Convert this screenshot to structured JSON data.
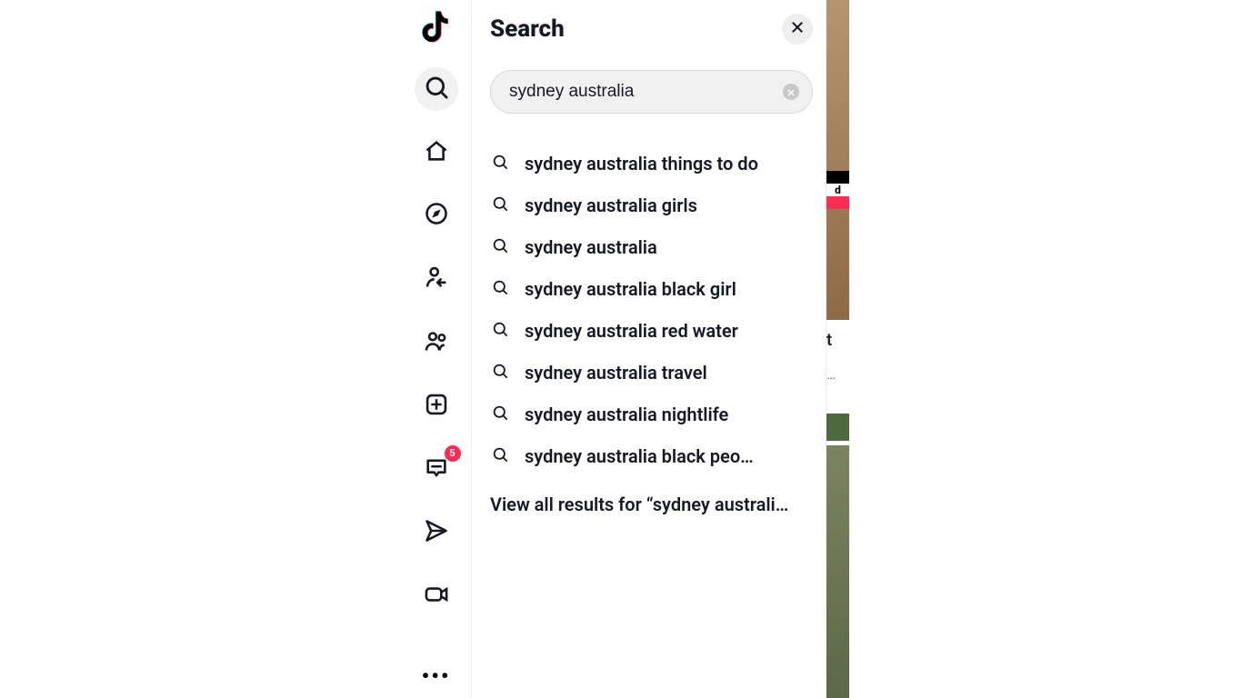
{
  "sidebar": {
    "items": [
      {
        "name": "logo"
      },
      {
        "name": "search",
        "active": true
      },
      {
        "name": "home"
      },
      {
        "name": "explore"
      },
      {
        "name": "following"
      },
      {
        "name": "friends"
      },
      {
        "name": "upload"
      },
      {
        "name": "activity",
        "badge": "5"
      },
      {
        "name": "messages"
      },
      {
        "name": "live"
      },
      {
        "name": "more"
      }
    ],
    "activity_badge": "5"
  },
  "search": {
    "title": "Search",
    "query": "sydney australia",
    "suggestions": [
      "sydney australia things to do",
      "sydney australia girls",
      "sydney australia",
      "sydney australia black girl",
      "sydney australia red water",
      "sydney australia travel",
      "sydney australia nightlife",
      "sydney australia black peo…"
    ],
    "view_all_label": "View all results for “sydney australi…"
  },
  "peek": {
    "flag_text": "d",
    "line1": "t",
    "line2": "…"
  }
}
